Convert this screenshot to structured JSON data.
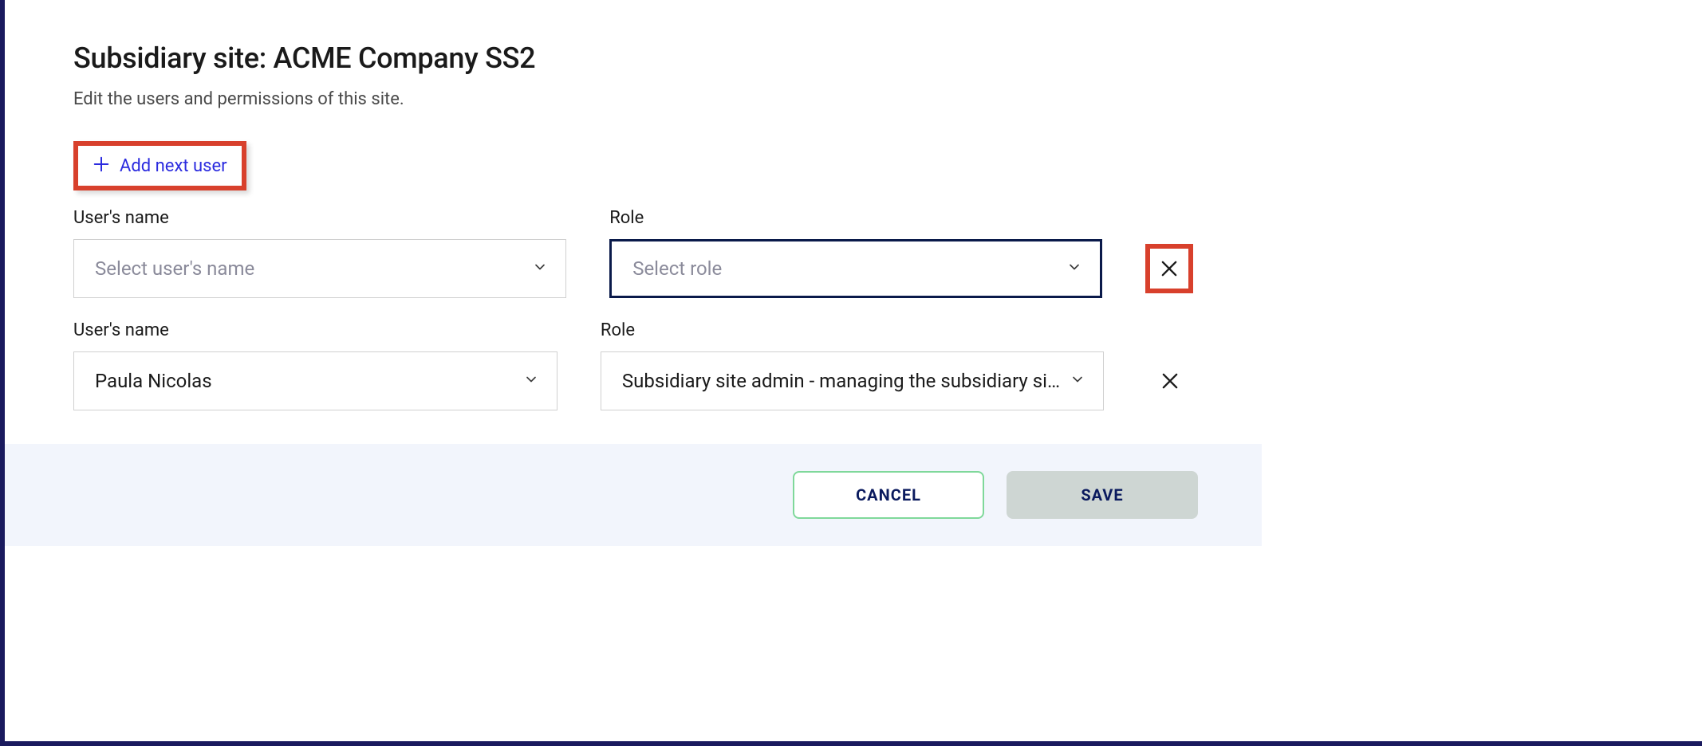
{
  "header": {
    "title": "Subsidiary site: ACME Company SS2",
    "subtitle": "Edit the users and permissions of this site."
  },
  "add_user": {
    "label": "Add next user"
  },
  "labels": {
    "user_name": "User's name",
    "role": "Role"
  },
  "placeholders": {
    "select_name": "Select user's name",
    "select_role": "Select role"
  },
  "rows": [
    {
      "name": "",
      "role": "",
      "role_focused": true,
      "remove_highlighted": true
    },
    {
      "name": "Paula Nicolas",
      "role": "Subsidiary site admin - managing the subsidiary si…",
      "role_focused": false,
      "remove_highlighted": false
    }
  ],
  "footer": {
    "cancel": "CANCEL",
    "save": "SAVE"
  }
}
